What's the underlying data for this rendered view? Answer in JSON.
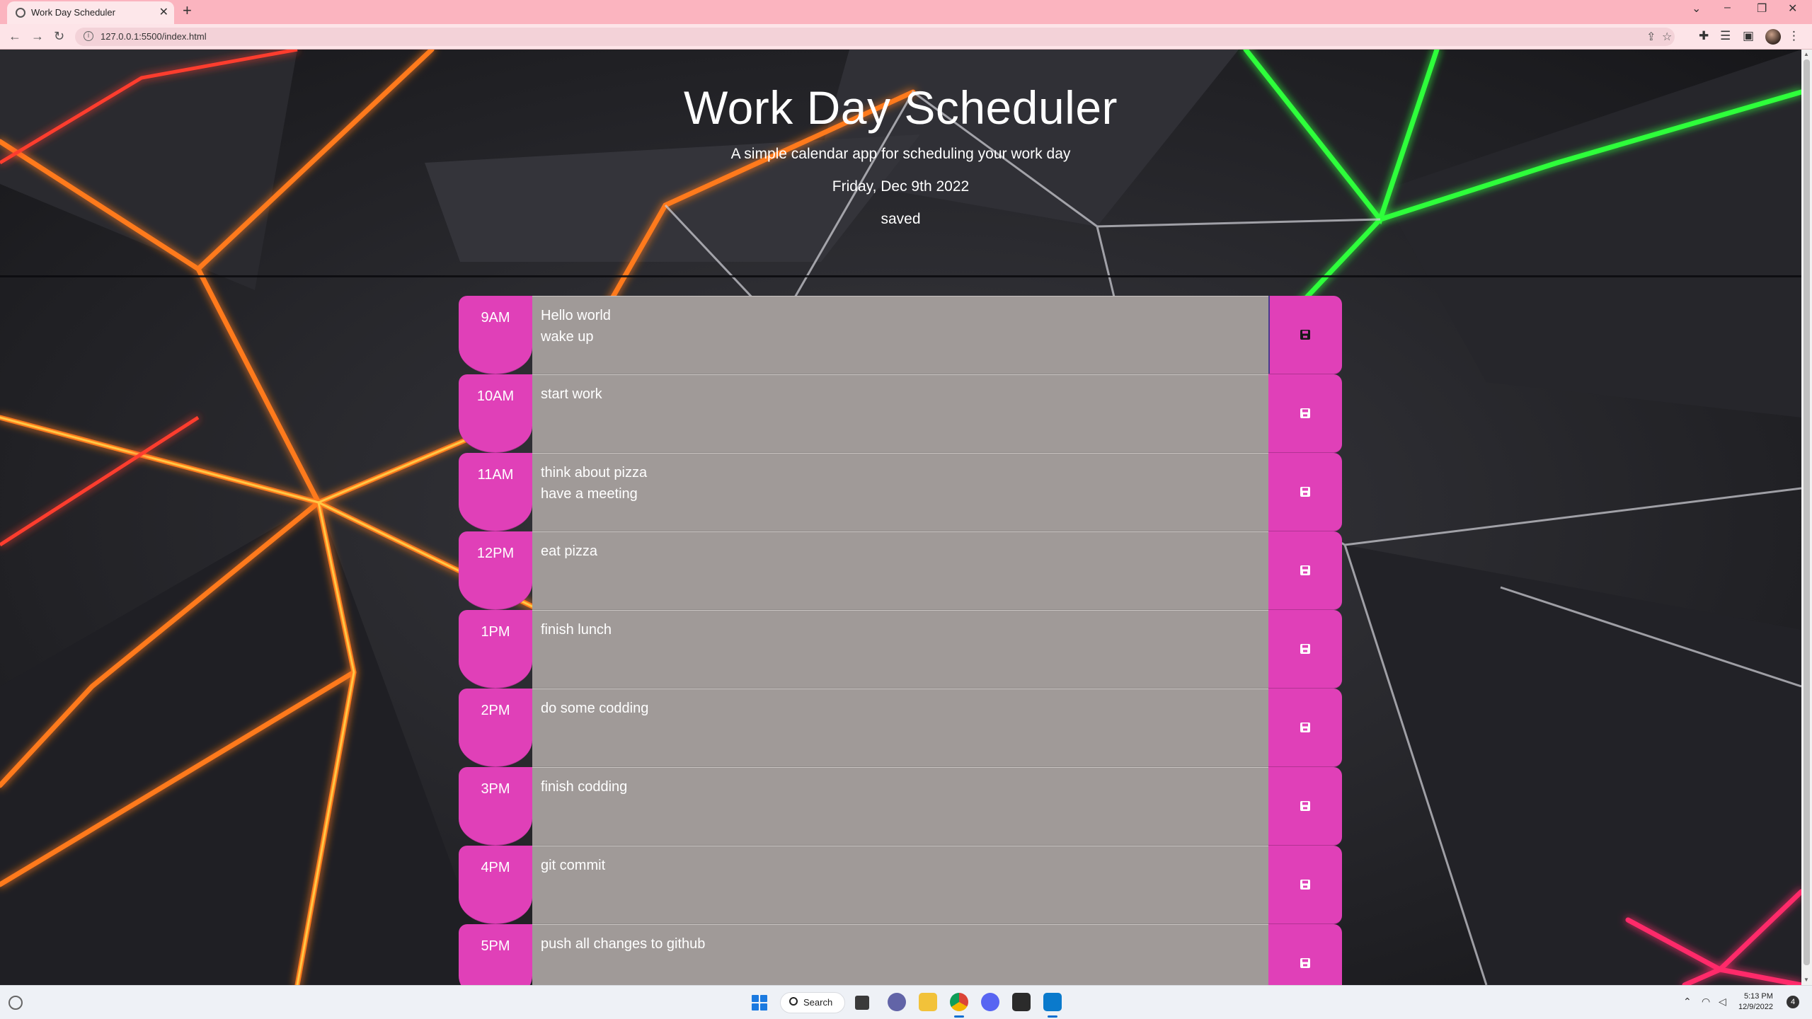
{
  "browser": {
    "tab_title": "Work Day Scheduler",
    "url": "127.0.0.1:5500/index.html"
  },
  "header": {
    "title": "Work Day Scheduler",
    "lead": "A simple calendar app for scheduling your work day",
    "date": "Friday, Dec 9th 2022",
    "status": "saved"
  },
  "timeblocks": [
    {
      "hour": "9AM",
      "lines": [
        "Hello world",
        "wake up"
      ]
    },
    {
      "hour": "10AM",
      "lines": [
        "start work",
        ""
      ]
    },
    {
      "hour": "11AM",
      "lines": [
        "think about pizza",
        "have a meeting"
      ]
    },
    {
      "hour": "12PM",
      "lines": [
        "eat pizza",
        ""
      ]
    },
    {
      "hour": "1PM",
      "lines": [
        "finish lunch",
        ""
      ]
    },
    {
      "hour": "2PM",
      "lines": [
        "do some codding",
        ""
      ]
    },
    {
      "hour": "3PM",
      "lines": [
        "finish codding",
        ""
      ]
    },
    {
      "hour": "4PM",
      "lines": [
        "git commit",
        ""
      ]
    },
    {
      "hour": "5PM",
      "lines": [
        "push all changes to github",
        ""
      ]
    }
  ],
  "taskbar": {
    "search_label": "Search",
    "time": "5:13 PM",
    "date": "12/9/2022",
    "notifications": "4"
  },
  "colors": {
    "accent": "#e040b8",
    "task_bg": "#a09a98",
    "tab_strip": "#fbb4bf"
  }
}
